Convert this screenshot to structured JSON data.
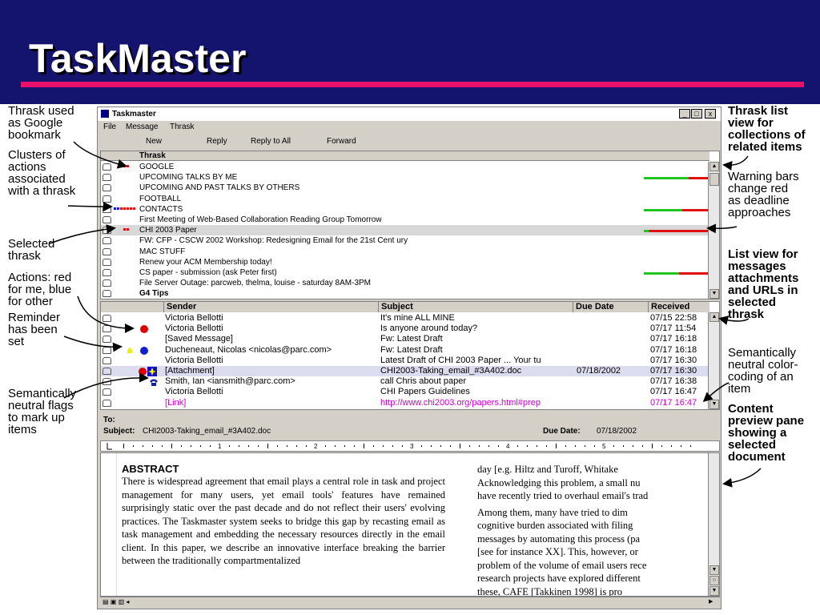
{
  "slide": {
    "title": "TaskMaster"
  },
  "annotations_left": {
    "thrask_bookmark": "Thrask used\nas Google\nbookmark",
    "clusters": "Clusters of\nactions\nassociated\nwith a thrask",
    "selected": "Selected\nthrask",
    "actions": "Actions: red\nfor me, blue\nfor other",
    "reminder": "Reminder\nhas been\nset",
    "flags": "Semantically\nneutral flags\nto mark up\nitems"
  },
  "annotations_right": {
    "list_view": "Thrask list\nview for\ncollections of\nrelated items",
    "warning": "Warning bars\nchange red\nas deadline\napproaches",
    "msg_view": "List view for\nmessages\nattachments\nand URLs in\nselected\nthrask",
    "color_coding": "Semantically\nneutral color-\ncoding of an\nitem",
    "preview": "Content\npreview pane\nshowing a\nselected\ndocument"
  },
  "window": {
    "title": "Taskmaster",
    "min_btn": "_",
    "max_btn": "□",
    "close_btn": "x",
    "menu": [
      "File",
      "Message",
      "Thrask"
    ],
    "toolbar": [
      "New",
      "Reply",
      "Reply to All",
      "Forward"
    ]
  },
  "thrask_list": {
    "header": "Thrask",
    "items": [
      {
        "name": "GOOGLE",
        "bold": false,
        "bar": false,
        "red": 0
      },
      {
        "name": "UPCOMING TALKS BY ME",
        "bold": false,
        "bar": true,
        "red": 0.3
      },
      {
        "name": "UPCOMING AND PAST TALKS BY OTHERS",
        "bold": false,
        "bar": false,
        "red": 0
      },
      {
        "name": "FOOTBALL",
        "bold": false,
        "bar": false,
        "red": 0
      },
      {
        "name": "CONTACTS",
        "bold": false,
        "bar": true,
        "red": 0.4
      },
      {
        "name": "First Meeting of Web-Based Collaboration Reading Group Tomorrow",
        "bold": false,
        "bar": false,
        "red": 0
      },
      {
        "name": "CHI 2003 Paper",
        "bold": false,
        "bar": true,
        "red": 0.92,
        "selected": true
      },
      {
        "name": "FW: CFP - CSCW 2002 Workshop: Redesigning Email for the 21st Cent ury",
        "bold": false,
        "bar": false,
        "red": 0
      },
      {
        "name": "MAC STUFF",
        "bold": false,
        "bar": false,
        "red": 0
      },
      {
        "name": "Renew your ACM Membership today!",
        "bold": false,
        "bar": false,
        "red": 0
      },
      {
        "name": "CS paper - submission (ask Peter first)",
        "bold": false,
        "bar": true,
        "red": 0.45
      },
      {
        "name": "File Server Outage: parcweb, thelma, louise - saturday 8AM-3PM",
        "bold": false,
        "bar": false,
        "red": 0
      },
      {
        "name": "G4 Tips",
        "bold": true,
        "bar": false,
        "red": 0
      }
    ]
  },
  "messages": {
    "columns": [
      "Sender",
      "Subject",
      "Due Date",
      "Received"
    ],
    "rows": [
      {
        "sender": "Victoria Bellotti",
        "subject": "It's mine ALL MINE",
        "due": "",
        "received": "07/15 22:58",
        "icon": ""
      },
      {
        "sender": "Victoria Bellotti",
        "subject": "Is anyone around today?",
        "due": "",
        "received": "07/17 11:54",
        "icon": "red"
      },
      {
        "sender": "[Saved Message]",
        "subject": "Fw: Latest Draft",
        "due": "",
        "received": "07/17 16:18",
        "icon": ""
      },
      {
        "sender": "Ducheneaut, Nicolas <nicolas@parc.com>",
        "subject": "Fw: Latest Draft",
        "due": "",
        "received": "07/17 16:18",
        "icon": "bell-blue"
      },
      {
        "sender": "Victoria Bellotti",
        "subject": "Latest Draft of CHI 2003 Paper ... Your tu",
        "due": "",
        "received": "07/17 16:30",
        "icon": ""
      },
      {
        "sender": "[Attachment]",
        "subject": "CHI2003-Taking_email_#3A402.doc",
        "due": "07/18/2002",
        "received": "07/17 16:30",
        "icon": "red-star",
        "selected": true
      },
      {
        "sender": "Smith, Ian <iansmith@parc.com>",
        "subject": "call Chris about paper",
        "due": "",
        "received": "07/17 16:38",
        "icon": "phone"
      },
      {
        "sender": "Victoria Bellotti",
        "subject": "CHI Papers Guidelines",
        "due": "",
        "received": "07/17 16:47",
        "icon": ""
      },
      {
        "sender": "[Link]",
        "subject": "http://www.chi2003.org/papers.html#prep",
        "due": "",
        "received": "07/17 16:47",
        "icon": "",
        "link": true
      }
    ]
  },
  "preview": {
    "to_label": "To:",
    "subject_label": "Subject:",
    "subject": "CHI2003-Taking_email_#3A402.doc",
    "due_label": "Due Date:",
    "due": "07/18/2002"
  },
  "doc": {
    "heading": "ABSTRACT",
    "col1": "There is widespread agreement that email plays a central role in task and project management for many users, yet email tools' features have remained surprisingly static over the past decade and do not reflect their users' evolving practices. The Taskmaster system seeks to bridge this gap by recasting email as task management and embedding the necessary resources directly in the email client. In this paper, we describe an innovative interface breaking the barrier between the traditionally compartmentalized",
    "col2_lines": [
      "day [e.g. Hiltz and Turoff, Whitake",
      "Acknowledging this problem, a small nu",
      "have recently tried to overhaul email's trad",
      "Among them, many have tried to dim",
      "cognitive burden associated with filing",
      "messages by automating this process (pa",
      "[see for instance XX]. This, however, or",
      "problem of the volume of email users rece",
      "research projects have explored different",
      "these, CAFE [Takkinen 1998] is pro"
    ]
  },
  "colors": {
    "header_bg": "#14146e",
    "accent": "#e8106a",
    "bar_green": "#22c422",
    "bar_red": "#e01010"
  }
}
